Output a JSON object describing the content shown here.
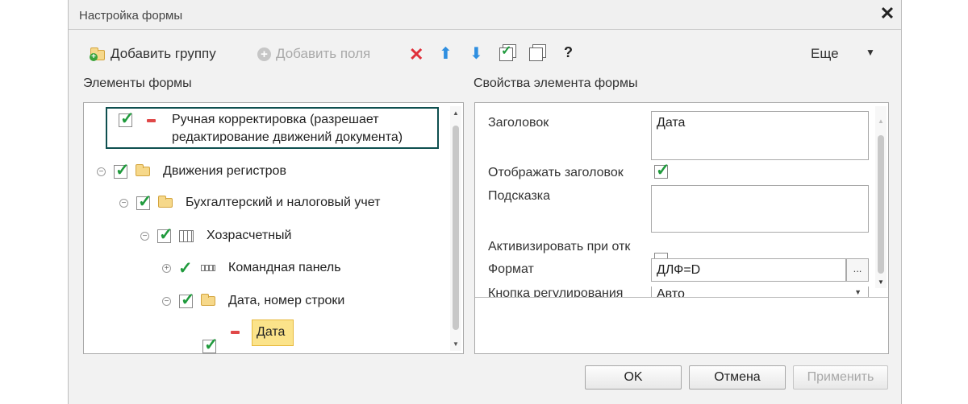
{
  "window": {
    "title": "Настройка формы"
  },
  "toolbar": {
    "add_group_label": "Добавить группу",
    "add_fields_label": "Добавить поля",
    "more_label": "Еще",
    "help_label": "?"
  },
  "sections": {
    "elements_title": "Элементы формы",
    "properties_title": "Свойства элемента формы"
  },
  "tree": {
    "manual_correction_line1": "Ручная корректировка (разрешает",
    "manual_correction_line2": "редактирование движений документа)",
    "register_movements": "Движения регистров",
    "accounting": "Бухгалтерский и налоговый учет",
    "khozraschetny": "Хозрасчетный",
    "command_panel": "Командная панель",
    "date_row_number": "Дата, номер строки",
    "date": "Дата"
  },
  "properties": {
    "title_label": "Заголовок",
    "title_value": "Дата",
    "show_title_label": "Отображать заголовок",
    "hint_label": "Подсказка",
    "hint_value": "",
    "activate_label": "Активизировать при отк",
    "format_label": "Формат",
    "format_value": "ДЛФ=D",
    "ellipsis": "...",
    "adjust_button_label": "Кнопка регулирования",
    "adjust_button_value": "Авто"
  },
  "buttons": {
    "ok": "OK",
    "cancel": "Отмена",
    "apply": "Применить"
  },
  "colors": {
    "check_green": "#1f9a3c",
    "delete_red": "#e0303a",
    "arrow_blue": "#2f8fe0",
    "highlight_yellow": "#fbe38a",
    "focus_border": "#0e4f4f"
  }
}
